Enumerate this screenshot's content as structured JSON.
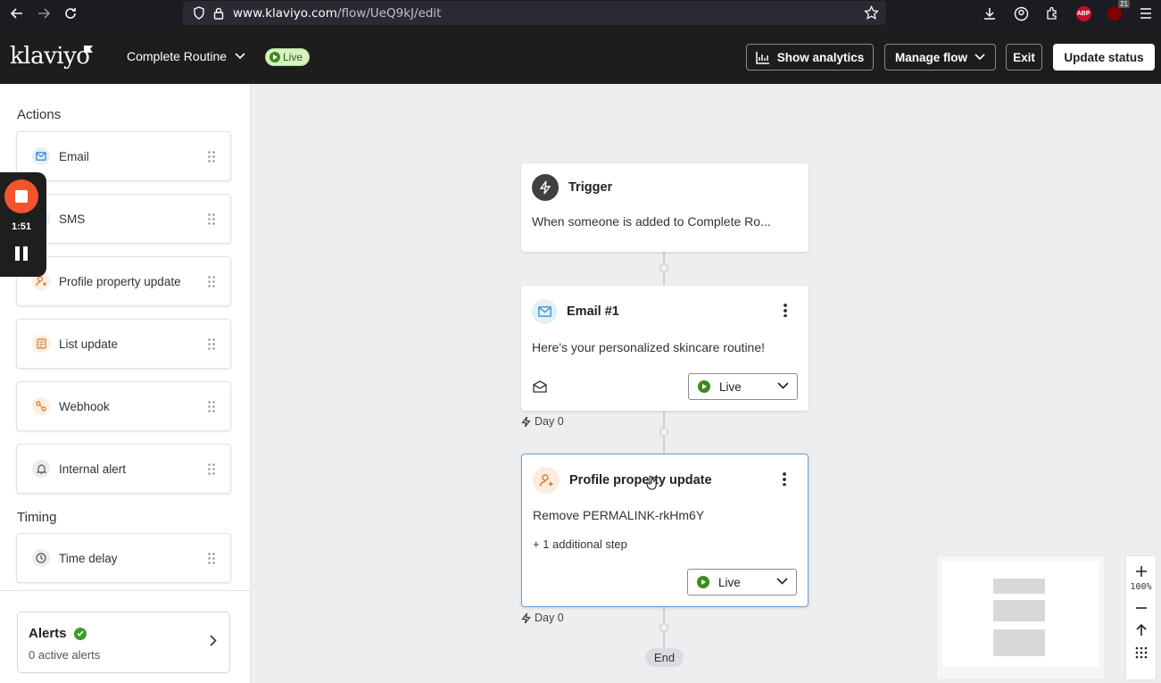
{
  "browser": {
    "url_domain": "www.klaviyo.com",
    "url_path": "/flow/UeQ9kJ/edit",
    "abp_label": "ABP",
    "ublock_count": "21"
  },
  "header": {
    "logo": "klaviyo",
    "flow_name": "Complete Routine",
    "status_pill": "Live",
    "show_analytics": "Show analytics",
    "manage_flow": "Manage flow",
    "exit": "Exit",
    "update_status": "Update status"
  },
  "sidebar": {
    "actions_title": "Actions",
    "actions": [
      {
        "label": "Email",
        "icon": "mail-icon"
      },
      {
        "label": "SMS",
        "icon": "sms-icon"
      },
      {
        "label": "Profile property update",
        "icon": "profile-icon"
      },
      {
        "label": "List update",
        "icon": "list-icon"
      },
      {
        "label": "Webhook",
        "icon": "webhook-icon"
      },
      {
        "label": "Internal alert",
        "icon": "bell-icon"
      }
    ],
    "timing_title": "Timing",
    "timing": [
      {
        "label": "Time delay",
        "icon": "clock-icon"
      }
    ],
    "alerts": {
      "title": "Alerts",
      "subtitle": "0 active alerts"
    }
  },
  "recorder": {
    "time": "1:51"
  },
  "flow": {
    "trigger": {
      "title": "Trigger",
      "body": "When someone is added to Complete Ro..."
    },
    "email": {
      "title": "Email #1",
      "body": "Here's your personalized skincare routine!",
      "status": "Live",
      "delay": "Day 0"
    },
    "profile_update": {
      "title": "Profile property update",
      "body": "Remove PERMALINK-rkHm6Y",
      "extra": "+ 1 additional step",
      "status": "Live",
      "delay": "Day 0"
    },
    "end": "End"
  },
  "zoom": {
    "level": "100%"
  },
  "colors": {
    "accent_live": "#3d8a1c",
    "selected_border": "#6f9fd9",
    "header_bg": "#1d1d1d",
    "recorder_stop": "#f2542d"
  }
}
